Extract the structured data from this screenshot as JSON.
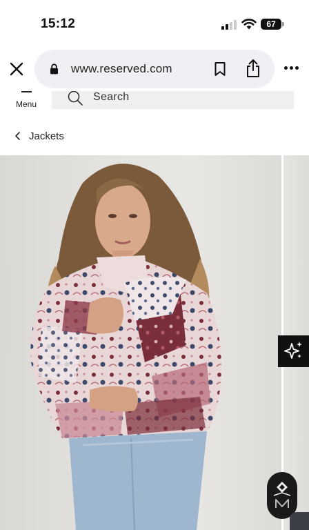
{
  "status_bar": {
    "time": "15:12",
    "battery": "67"
  },
  "browser": {
    "url": "www.reserved.com",
    "icons": [
      "close-icon",
      "lock-icon",
      "bookmark-icon",
      "share-icon",
      "more-icon"
    ]
  },
  "header": {
    "menu_label": "Menu",
    "search_label": "Search"
  },
  "breadcrumb": {
    "label": "Jackets"
  },
  "product": {
    "image_alt_name": "product-photo-patchwork-jacket",
    "ai_button_icon": "sparkles-icon",
    "badge_icon": "brand-logo-icon"
  },
  "colors": {
    "accent_dark": "#111111",
    "url_pill": "#eef0f3",
    "search_bg": "#efefef",
    "jacket_burgundy": "#7a2e3a",
    "jacket_navy": "#3d4a6b",
    "denim": "#9fb6cf"
  }
}
